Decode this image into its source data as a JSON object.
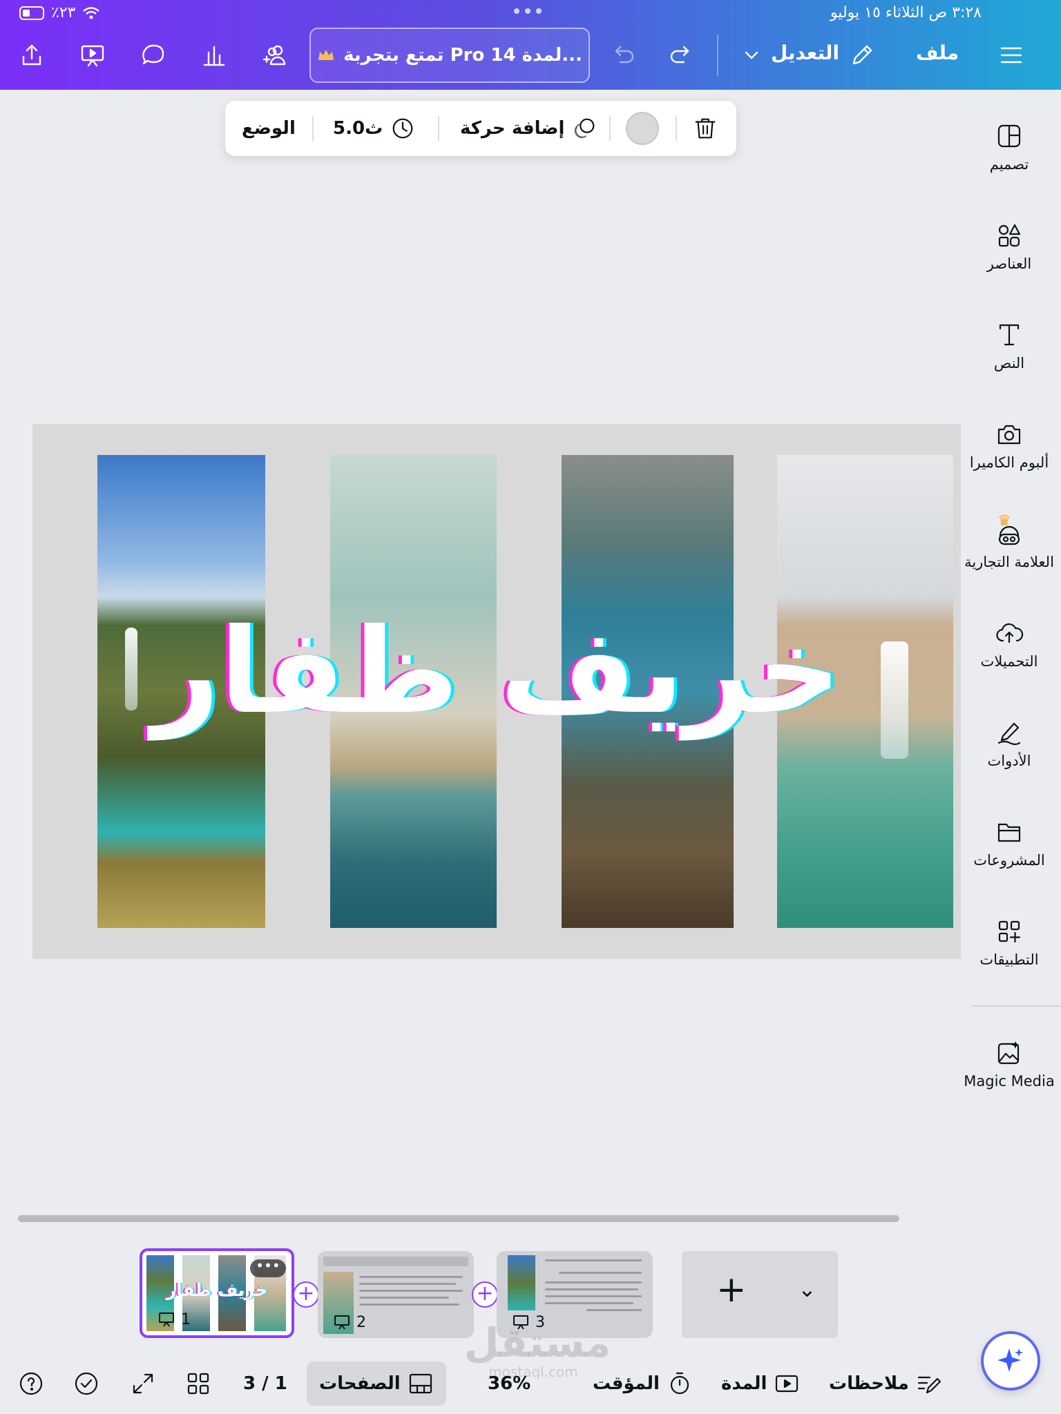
{
  "status_bar": {
    "time": "٣:٢٨ ص  الثلاثاء ١٥ يوليو",
    "battery": "٪٢٣"
  },
  "topbar": {
    "menu_label": "ملف",
    "edit_label": "التعديل",
    "pro_text": "تمتع بتجربة Pro لمدة 14...",
    "icons": [
      "menu-icon",
      "pencil-icon",
      "chevron-down-icon",
      "redo-icon",
      "undo-icon",
      "crown-icon",
      "add-people-icon",
      "chart-icon",
      "comment-icon",
      "present-icon",
      "share-icon"
    ]
  },
  "context_toolbar": {
    "position_label": "الوضع",
    "duration_label": "5.0ث",
    "animate_label": "إضافة حركة",
    "color": "#d9d9d9"
  },
  "sidebar": {
    "items": [
      {
        "label": "تصميم",
        "icon": "design-icon"
      },
      {
        "label": "العناصر",
        "icon": "elements-icon"
      },
      {
        "label": "النص",
        "icon": "text-icon"
      },
      {
        "label": "ألبوم الكاميرا",
        "icon": "camera-icon"
      },
      {
        "label": "العلامة التجارية",
        "icon": "brand-icon"
      },
      {
        "label": "التحميلات",
        "icon": "upload-cloud-icon"
      },
      {
        "label": "الأدوات",
        "icon": "draw-icon"
      },
      {
        "label": "المشروعات",
        "icon": "folder-icon"
      },
      {
        "label": "التطبيقات",
        "icon": "apps-icon"
      },
      {
        "label": "Magic Media",
        "icon": "magic-media-icon"
      }
    ]
  },
  "canvas": {
    "title": "خريف ظفار",
    "background": "#d9d9d9"
  },
  "pages": {
    "thumbs": [
      {
        "number": "1",
        "title": "خريف ظفار",
        "more": "•••"
      },
      {
        "number": "2"
      },
      {
        "number": "3"
      }
    ]
  },
  "bottombar": {
    "notes_label": "ملاحظات",
    "duration_label": "المدة",
    "timer_label": "المؤقت",
    "zoom": "36%",
    "pages_label": "الصفحات",
    "page_counter": "3 / 1"
  },
  "watermark": {
    "big": "مستقل",
    "small": "mostaql.com"
  },
  "colors": {
    "accent": "#8b3dff",
    "gradient_start": "#7b2ff7",
    "gradient_end": "#1fa9d6"
  }
}
